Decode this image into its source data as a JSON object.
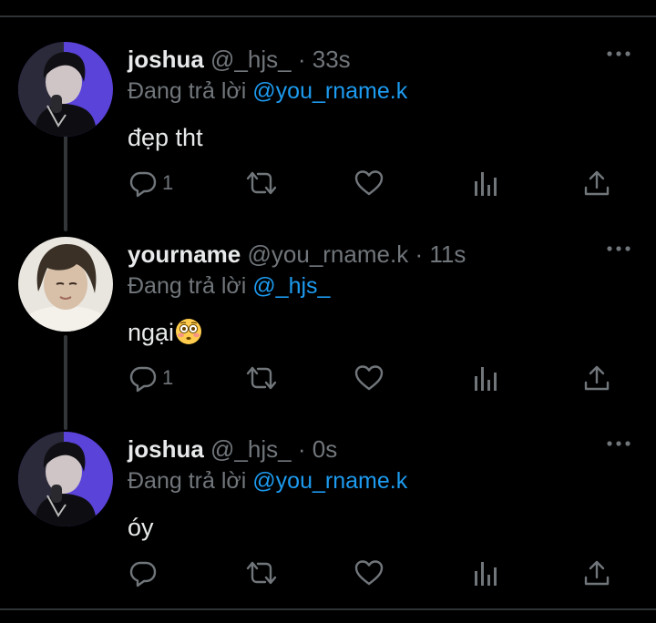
{
  "colors": {
    "background": "#000000",
    "text_primary": "#e7e9ea",
    "text_secondary": "#71767b",
    "mention": "#1d9bf0",
    "thread_line": "#333639"
  },
  "icons": {
    "more": "more-horizontal-icon",
    "reply": "speech-bubble-icon",
    "retweet": "retweet-arrows-icon",
    "like": "heart-outline-icon",
    "views": "bar-chart-icon",
    "share": "share-upload-icon",
    "emoji": "flushed-face-emoji"
  },
  "tweets": [
    {
      "name": "joshua",
      "handle": "@_hjs_",
      "separator": "·",
      "time": "33s",
      "reply_prefix": "Đang trả lời",
      "reply_to": "@you_rname.k",
      "text": "đẹp tht",
      "reply_count": "1"
    },
    {
      "name": "yourname",
      "handle": "@you_rname.k",
      "separator": "·",
      "time": "11s",
      "reply_prefix": "Đang trả lời",
      "reply_to": "@_hjs_",
      "text": "ngại",
      "emoji": "😳",
      "reply_count": "1"
    },
    {
      "name": "joshua",
      "handle": "@_hjs_",
      "separator": "·",
      "time": "0s",
      "reply_prefix": "Đang trả lời",
      "reply_to": "@you_rname.k",
      "text": "óy",
      "reply_count": ""
    }
  ]
}
